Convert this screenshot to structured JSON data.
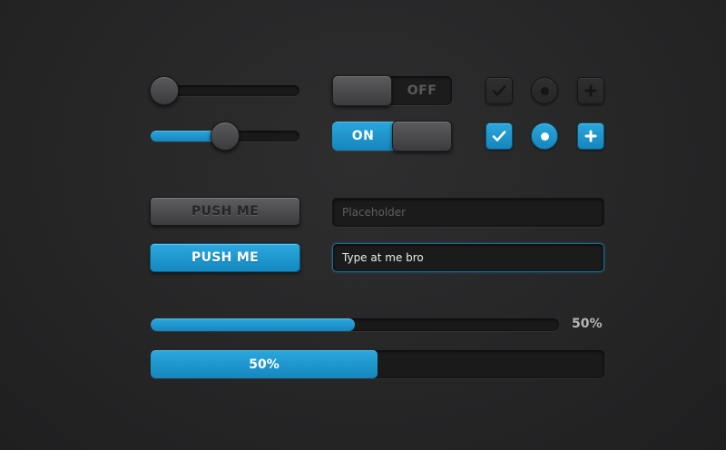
{
  "colors": {
    "accent": "#1f9bd1",
    "background": "#262627",
    "muted_label": "#5a5a5c"
  },
  "sliders": [
    {
      "name": "slider-1",
      "value_fraction": 0.0
    },
    {
      "name": "slider-2",
      "value_fraction": 0.5
    }
  ],
  "toggles": {
    "off": {
      "label": "OFF",
      "state": "off"
    },
    "on": {
      "label": "ON",
      "state": "on"
    }
  },
  "checks": {
    "off_row": [
      {
        "type": "checkbox",
        "icon": "checkmark-icon",
        "checked": false
      },
      {
        "type": "radio",
        "icon": "dot-icon",
        "checked": false
      },
      {
        "type": "plus",
        "icon": "plus-icon",
        "checked": false
      }
    ],
    "on_row": [
      {
        "type": "checkbox",
        "icon": "checkmark-icon",
        "checked": true
      },
      {
        "type": "radio",
        "icon": "dot-icon",
        "checked": true
      },
      {
        "type": "plus",
        "icon": "plus-icon",
        "checked": true
      }
    ]
  },
  "buttons": {
    "primary_label": "PUSH ME",
    "secondary_label": "PUSH ME"
  },
  "inputs": {
    "empty_placeholder": "Placeholder",
    "filled_value": "Type at me bro"
  },
  "progress": {
    "thin": {
      "value_percent": 50,
      "label": "50%"
    },
    "thick": {
      "value_percent": 50,
      "label": "50%"
    }
  }
}
